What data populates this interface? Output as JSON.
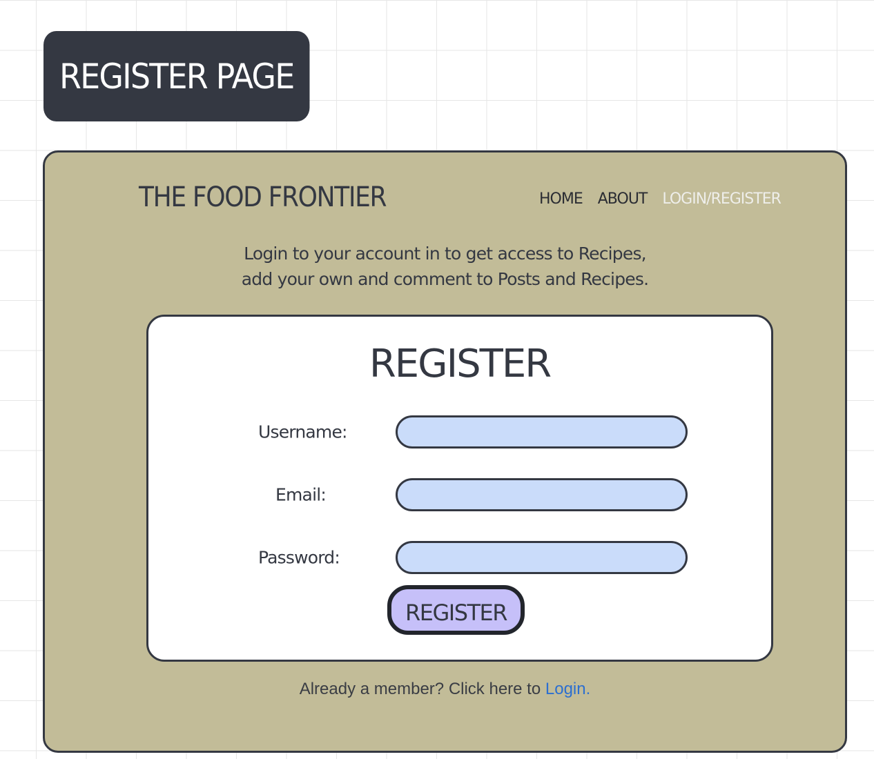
{
  "page_tag": "REGISTER PAGE",
  "header": {
    "brand": "THE FOOD FRONTIER",
    "nav": [
      {
        "label": "HOME",
        "active": false
      },
      {
        "label": "ABOUT",
        "active": false
      },
      {
        "label": "LOGIN/REGISTER",
        "active": true
      }
    ]
  },
  "intro": {
    "line1": "Login to your account in to get access to Recipes,",
    "line2": "add your own and comment to Posts and Recipes."
  },
  "form": {
    "title": "REGISTER",
    "fields": [
      {
        "label": "Username:",
        "value": "",
        "placeholder": ""
      },
      {
        "label": "Email:",
        "value": "",
        "placeholder": ""
      },
      {
        "label": "Password:",
        "value": "",
        "placeholder": ""
      }
    ],
    "submit_label": "REGISTER"
  },
  "footer": {
    "prompt": "Already a member? Click here to ",
    "link_label": "Login."
  },
  "colors": {
    "frame_background": "#c2bc98",
    "tag_background": "#343842",
    "input_background": "#cadcfa",
    "button_background": "#c6c0f9",
    "link": "#2c6fd0",
    "active_nav": "#eeeeea"
  }
}
